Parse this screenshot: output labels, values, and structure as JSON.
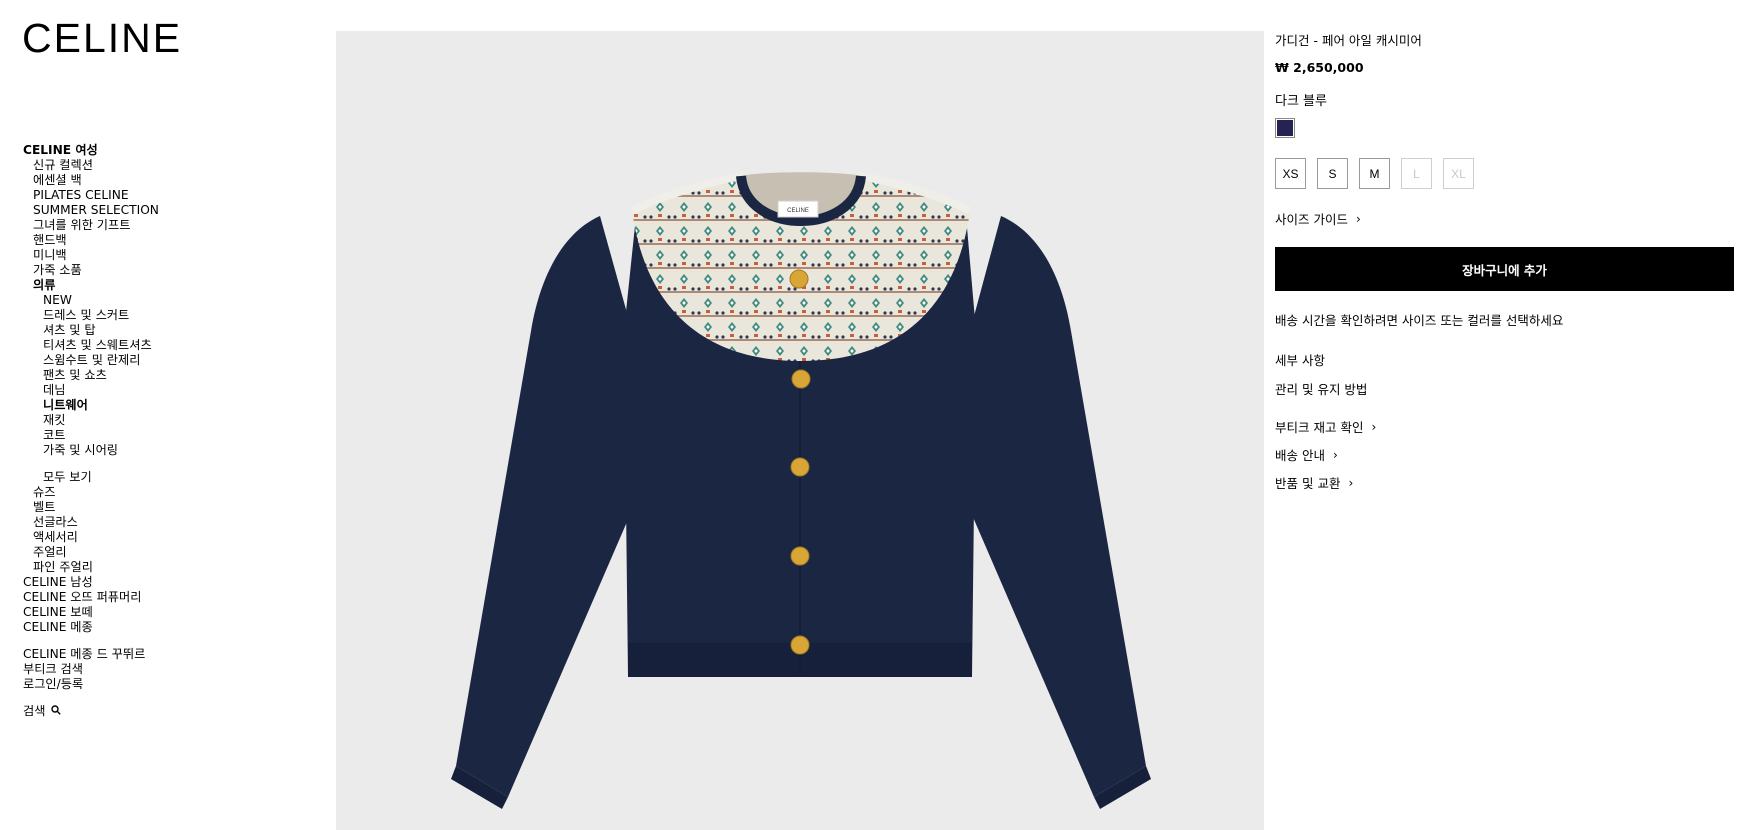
{
  "brand": "CELINE",
  "nav": {
    "women": "CELINE 여성",
    "women_top": [
      "신규 컬렉션",
      "에센셜 백",
      "PILATES CELINE",
      "SUMMER SELECTION",
      "그녀를 위한 기프트"
    ],
    "women_cats1": [
      "핸드백",
      "미니백",
      "가죽 소품"
    ],
    "clothing": "의류",
    "clothing_items": [
      "NEW",
      "드레스 및 스커트",
      "셔츠 및 탑",
      "티셔츠 및 스웨트셔츠",
      "스윔수트 및 란제리",
      "팬츠 및 쇼츠",
      "데님",
      "니트웨어",
      "재킷",
      "코트",
      "가죽 및 시어링"
    ],
    "view_all": "모두 보기",
    "women_cats2": [
      "슈즈",
      "벨트",
      "선글라스",
      "액세서리",
      "주얼리",
      "파인 주얼리"
    ],
    "other_sections": [
      "CELINE 남성",
      "CELINE 오뜨 퍼퓨머리",
      "CELINE 보떼",
      "CELINE 메종"
    ],
    "maison_couture": "CELINE 메종 드 꾸뛰르",
    "store_locator": "부티크 검색",
    "login": "로그인/등록",
    "search": "검색"
  },
  "product": {
    "title": "가디건 - 페어 아일 캐시미어",
    "price": "₩ 2,650,000",
    "color_name": "다크 블루",
    "swatch_color": "#252352",
    "sizes": [
      {
        "label": "XS",
        "available": true
      },
      {
        "label": "S",
        "available": true
      },
      {
        "label": "M",
        "available": true
      },
      {
        "label": "L",
        "available": false
      },
      {
        "label": "XL",
        "available": false
      }
    ],
    "size_guide": "사이즈 가이드",
    "add_to_cart": "장바구니에 추가",
    "shipping_message": "배송 시간을 확인하려면 사이즈 또는 컬러를 선택하세요",
    "details": "세부 사항",
    "care": "관리 및 유지 방법",
    "boutique_stock": "부티크 재고 확인",
    "shipping_info": "배송 안내",
    "returns": "반품 및 교환",
    "label_text": "CELINE"
  }
}
